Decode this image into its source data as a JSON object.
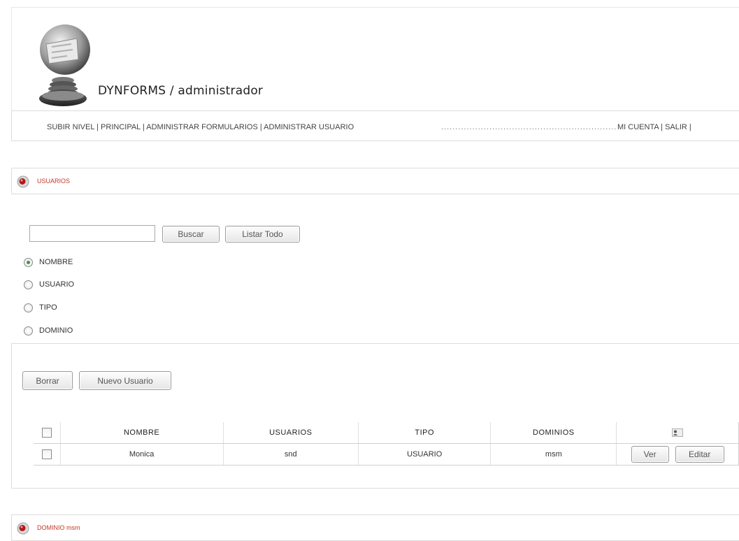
{
  "app": {
    "title": "DYNFORMS / administrador"
  },
  "nav": {
    "left": [
      {
        "label": "SUBIR NIVEL"
      },
      {
        "label": "PRINCIPAL"
      },
      {
        "label": "ADMINISTRAR FORMULARIOS"
      },
      {
        "label": "ADMINISTRAR USUARIO"
      }
    ],
    "dots": "...................................................................................................................",
    "right": [
      {
        "label": "MI CUENTA"
      },
      {
        "label": "SALIR"
      }
    ],
    "separator": "|"
  },
  "section_usuarios": {
    "label": "USUARIOS",
    "icon": "bullet-icon"
  },
  "search": {
    "value": "",
    "placeholder": "",
    "buscar_label": "Buscar",
    "listar_label": "Listar Todo"
  },
  "filters": [
    {
      "label": "NOMBRE",
      "checked": true
    },
    {
      "label": "USUARIO",
      "checked": false
    },
    {
      "label": "TIPO",
      "checked": false
    },
    {
      "label": "DOMINIO",
      "checked": false
    }
  ],
  "actions": {
    "borrar_label": "Borrar",
    "nuevo_label": "Nuevo Usuario"
  },
  "table": {
    "headers": [
      "NOMBRE",
      "USUARIOS",
      "TIPO",
      "DOMINIOS"
    ],
    "header_icon": "user-icon",
    "rows": [
      {
        "nombre": "Monica",
        "usuario": "snd",
        "tipo": "USUARIO",
        "dominio": "msm",
        "ver_label": "Ver",
        "editar_label": "Editar"
      }
    ]
  },
  "section_dominio": {
    "label": "DOMINIO msm",
    "icon": "bullet-icon"
  },
  "colors": {
    "accent": "#c0392b",
    "border": "#dcdcdc",
    "radio_dot": "#3a9a3a"
  }
}
